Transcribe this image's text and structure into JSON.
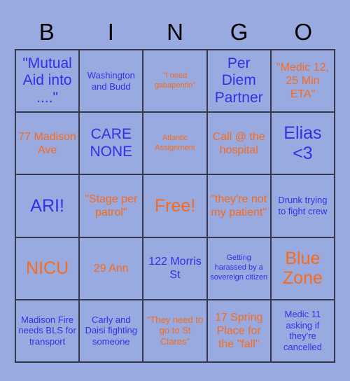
{
  "header": {
    "letters": [
      "B",
      "I",
      "N",
      "G",
      "O"
    ],
    "letter_color": "#000000"
  },
  "colors": {
    "background": "#98aadf",
    "cell_background": "#98aadf",
    "border": "#36394a",
    "text_blue": "#3030e8",
    "text_orange": "#fa6a18"
  },
  "grid": {
    "columns": 5,
    "rows": 5,
    "free_space_index": 12,
    "cells": [
      {
        "text": "\"Mutual Aid into ....\"",
        "color": "blue",
        "size": "lg"
      },
      {
        "text": "Washington and Budd",
        "color": "blue",
        "size": "sm"
      },
      {
        "text": "\"I need gabapentin\"",
        "color": "orange",
        "size": "xs"
      },
      {
        "text": "Per Diem Partner",
        "color": "blue",
        "size": "lg"
      },
      {
        "text": "\"Medic 12, 25 Min ETA\"",
        "color": "orange",
        "size": "md"
      },
      {
        "text": "77 Madison Ave",
        "color": "orange",
        "size": "md"
      },
      {
        "text": "CARE NONE",
        "color": "blue",
        "size": "lg"
      },
      {
        "text": "Atlantic Assignment",
        "color": "orange",
        "size": "xs"
      },
      {
        "text": "Call @ the hospital",
        "color": "orange",
        "size": "md"
      },
      {
        "text": "Elias <3",
        "color": "blue",
        "size": "xl"
      },
      {
        "text": "ARI!",
        "color": "blue",
        "size": "xl"
      },
      {
        "text": "\"Stage per patrol\"",
        "color": "orange",
        "size": "md"
      },
      {
        "text": "Free!",
        "color": "orange",
        "size": "xl"
      },
      {
        "text": "\"they're not my patient\"",
        "color": "orange",
        "size": "md"
      },
      {
        "text": "Drunk trying to fight crew",
        "color": "blue",
        "size": "sm"
      },
      {
        "text": "NICU",
        "color": "orange",
        "size": "xl"
      },
      {
        "text": "29 Ann",
        "color": "orange",
        "size": "md"
      },
      {
        "text": "122 Morris St",
        "color": "blue",
        "size": "md"
      },
      {
        "text": "Getting harassed by a sovereign citizen",
        "color": "blue",
        "size": "xs"
      },
      {
        "text": "Blue Zone",
        "color": "orange",
        "size": "xl"
      },
      {
        "text": "Madison Fire needs BLS for transport",
        "color": "blue",
        "size": "sm"
      },
      {
        "text": "Carly and Daisi fighting someone",
        "color": "blue",
        "size": "sm"
      },
      {
        "text": "\"They need to go to St Clares\"",
        "color": "orange",
        "size": "sm"
      },
      {
        "text": "17 Spring Place for the \"fall\"",
        "color": "orange",
        "size": "md"
      },
      {
        "text": "Medic 11 asking if they're cancelled",
        "color": "blue",
        "size": "sm"
      }
    ]
  }
}
